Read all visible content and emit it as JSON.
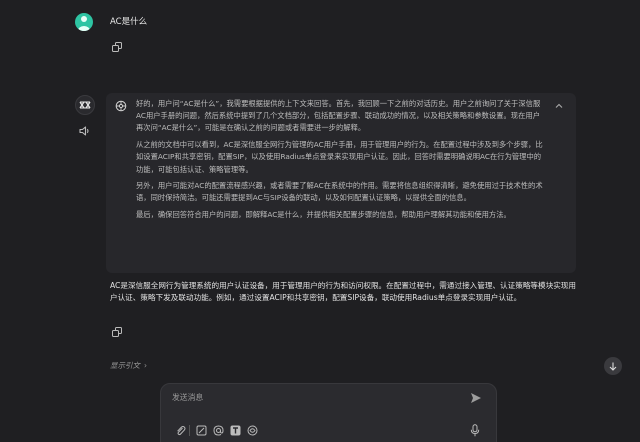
{
  "user_message": "AC是什么",
  "thinking": {
    "paragraphs": [
      "好的，用户问“AC是什么”，我需要根据提供的上下文来回答。首先，我回顾一下之前的对话历史。用户之前询问了关于深信服AC用户手册的问题，然后系统中提到了几个文档部分，包括配置步骤、联动成功的情况，以及相关策略和参数设置。现在用户再次问“AC是什么”，可能是在确认之前的问题或者需要进一步的解释。",
      "从之前的文档中可以看到，AC是深信服全网行为管理的AC用户手册，用于管理用户的行为。在配置过程中涉及到多个步骤，比如设置ACIP和共享密钥，配置SIP，以及使用Radius单点登录来实现用户认证。因此，回答时需要明确说明AC在行为管理中的功能，可能包括认证、策略管理等。",
      "另外，用户可能对AC的配置流程感兴趣，或者需要了解AC在系统中的作用。需要将信息组织得清晰，避免使用过于技术性的术语，同时保持简洁。可能还需要提到AC与SIP设备的联动，以及如何配置认证策略，以提供全面的信息。",
      "最后，确保回答符合用户的问题，即解释AC是什么，并提供相关配置步骤的信息，帮助用户理解其功能和使用方法。"
    ]
  },
  "answer": "AC是深信服全网行为管理系统的用户认证设备，用于管理用户的行为和访问权限。在配置过程中，需通过接入管理、认证策略等模块实现用户认证、策略下发及联动功能。例如，通过设置ACIP和共享密钥，配置SIP设备，联动使用Radius单点登录实现用户认证。",
  "show_refs_label": "显示引文",
  "composer": {
    "placeholder": "发送消息"
  },
  "icons": {
    "copy": "copy-icon",
    "speaker": "speaker-icon",
    "send": "send-icon",
    "attach": "paperclip-icon",
    "mic": "microphone-icon",
    "scroll_down": "arrow-down-icon"
  },
  "colors": {
    "background": "#1f1f22",
    "avatar_green": "#2ec4a3",
    "thinking_bg": "#27272b"
  }
}
